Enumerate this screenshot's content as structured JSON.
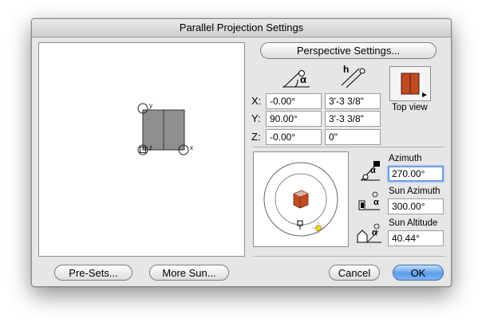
{
  "window": {
    "title": "Parallel Projection Settings"
  },
  "buttons": {
    "perspective": "Perspective Settings...",
    "presets": "Pre-Sets...",
    "more_sun": "More Sun...",
    "cancel": "Cancel",
    "ok": "OK"
  },
  "preview": {
    "axis_x": "x",
    "axis_y": "y",
    "axis_z": "z"
  },
  "coords": {
    "header_angle_symbol": "α",
    "header_length_symbol": "h",
    "rows": [
      {
        "label": "X:",
        "angle": "-0.00°",
        "length": "3'-3 3/8\""
      },
      {
        "label": "Y:",
        "angle": "90.00°",
        "length": "3'-3 3/8\""
      },
      {
        "label": "Z:",
        "angle": "-0.00°",
        "length": "0\""
      }
    ]
  },
  "view": {
    "label": "Top view"
  },
  "sun": {
    "azimuth_label": "Azimuth",
    "azimuth_value": "270.00°",
    "sun_azimuth_label": "Sun Azimuth",
    "sun_azimuth_value": "300.00°",
    "sun_altitude_label": "Sun Altitude",
    "sun_altitude_value": "40.44°",
    "alpha_symbol": "α"
  },
  "colors": {
    "accent_blue": "#5c9ceb",
    "model_red": "#c14a23",
    "preview_gray": "#8f8f8f"
  }
}
